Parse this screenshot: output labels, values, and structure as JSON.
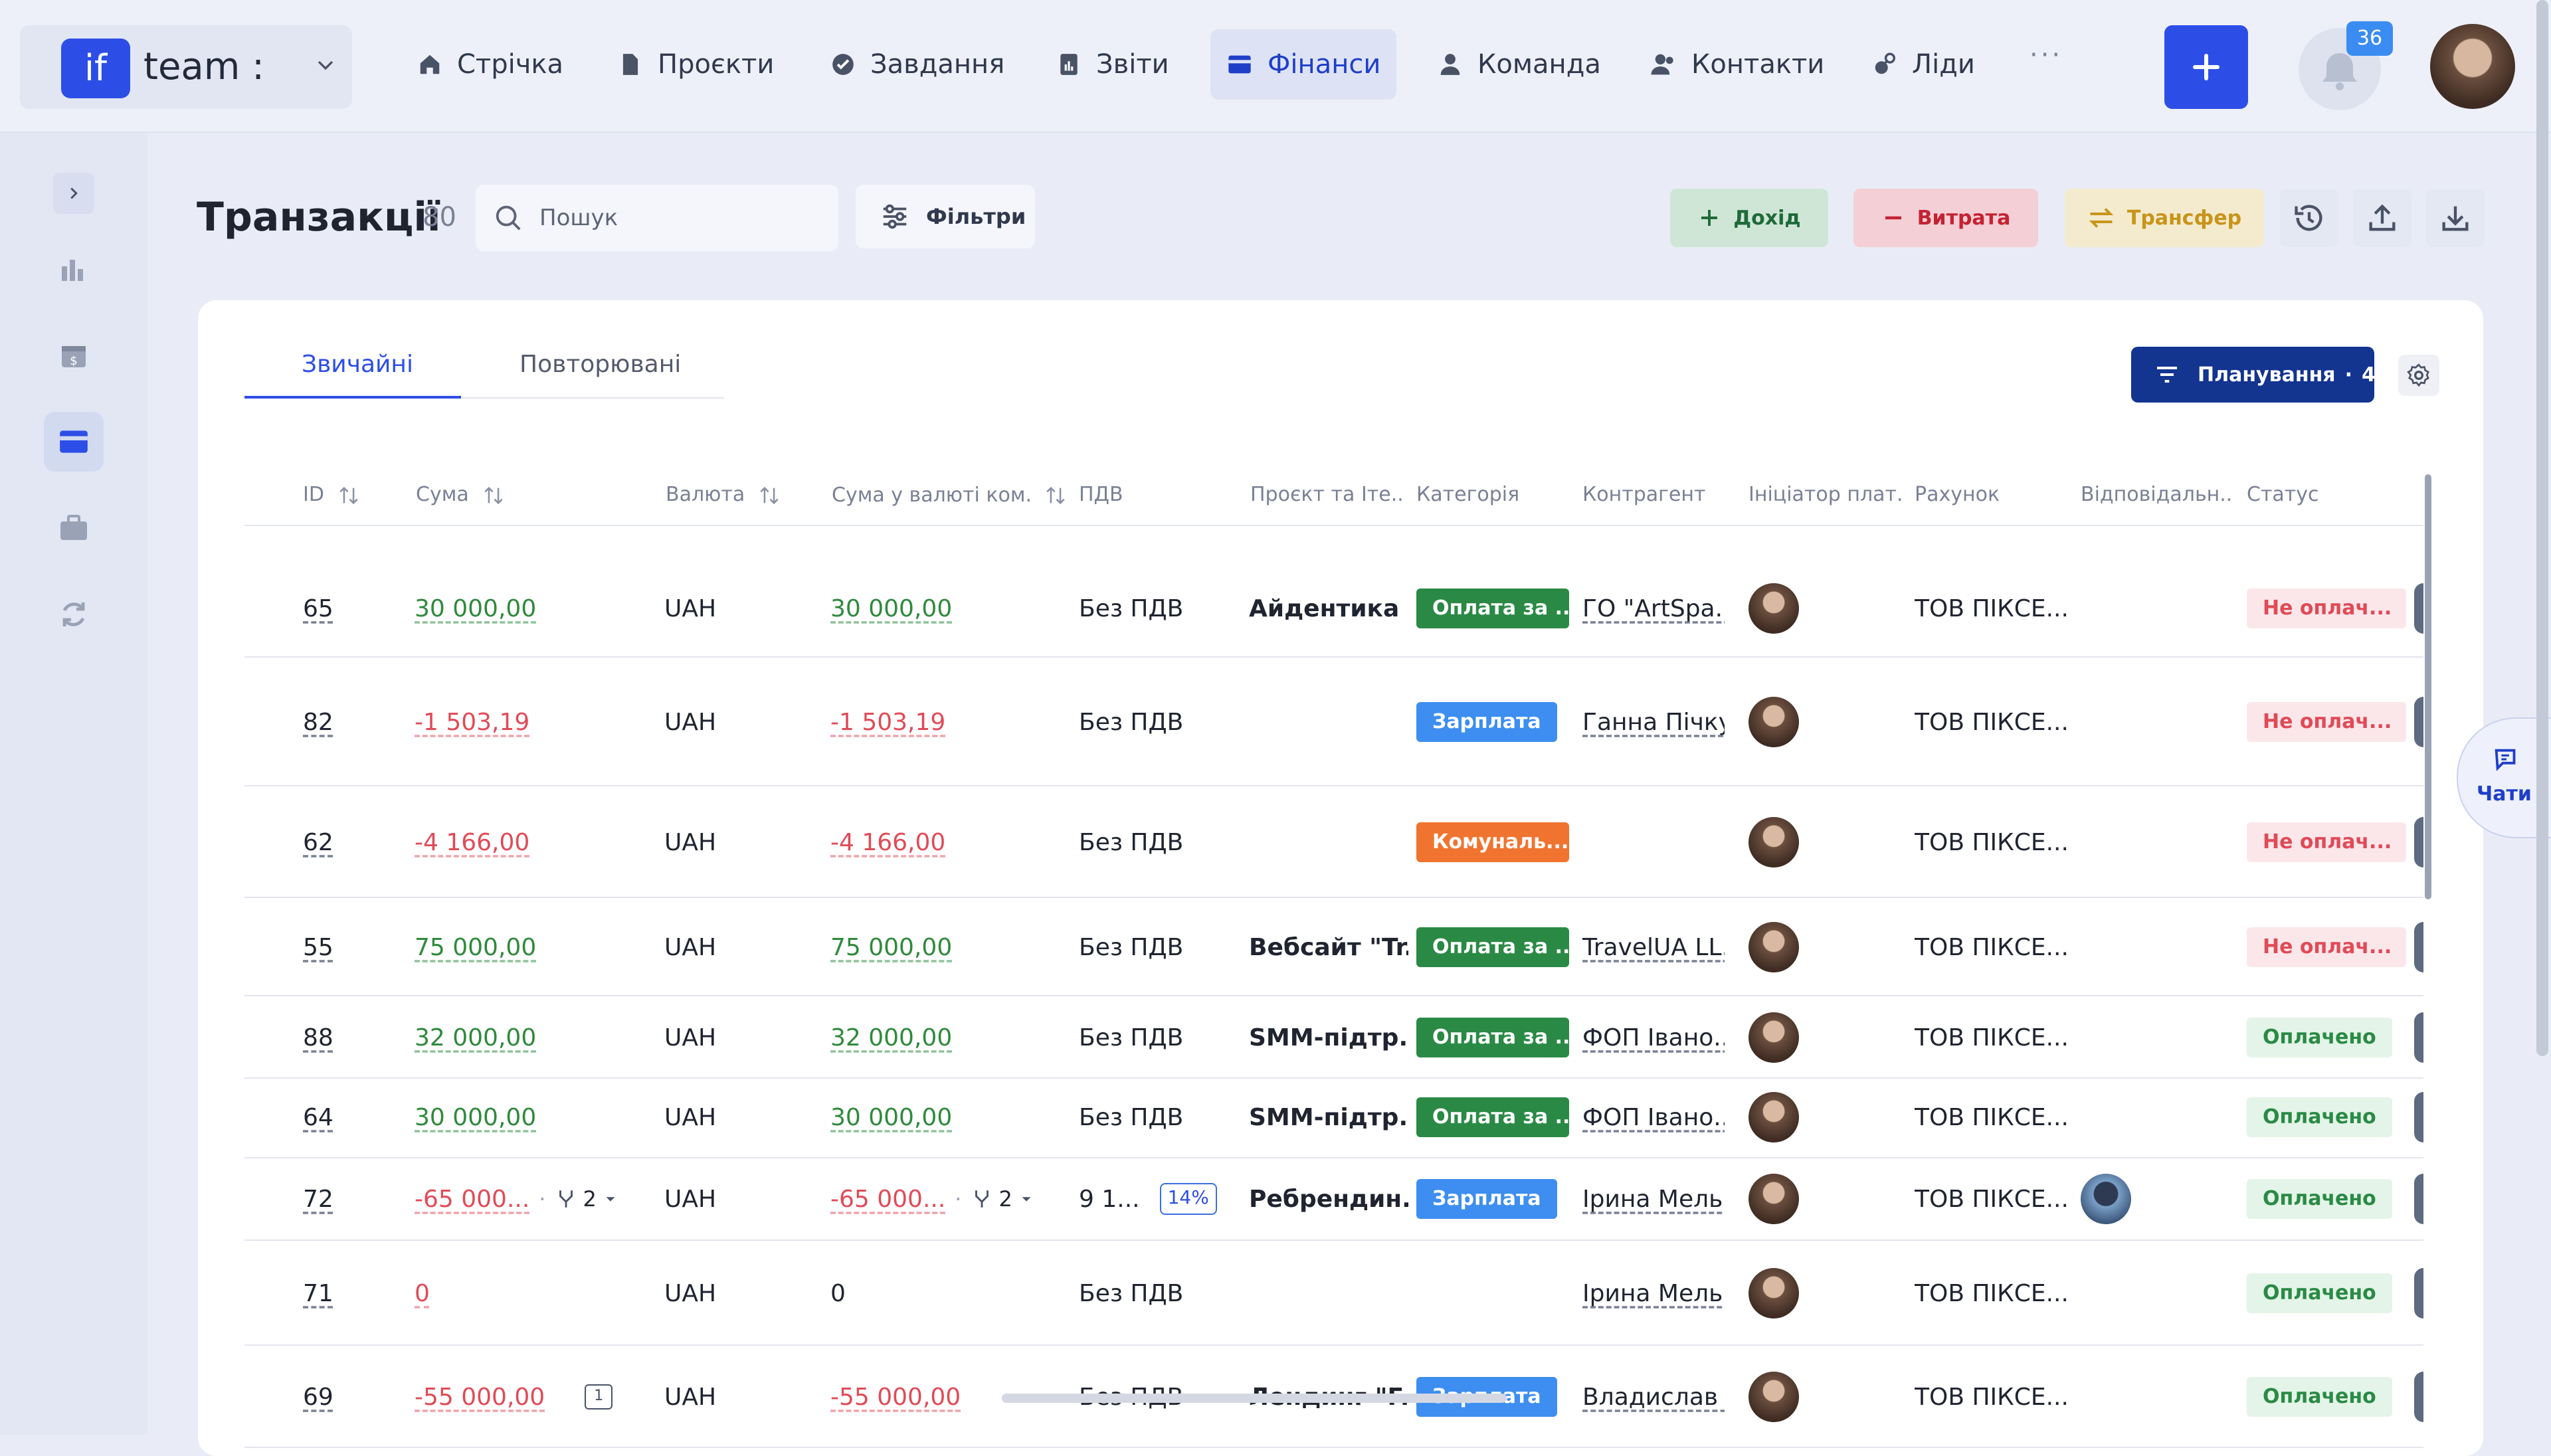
{
  "workspace": {
    "logo": "if",
    "name": "team :"
  },
  "nav": [
    {
      "label": "Стрічка",
      "icon": "home-icon"
    },
    {
      "label": "Проєкти",
      "icon": "file-icon"
    },
    {
      "label": "Завдання",
      "icon": "check-circle-icon"
    },
    {
      "label": "Звіти",
      "icon": "report-icon"
    },
    {
      "label": "Фінанси",
      "icon": "wallet-icon",
      "active": true
    },
    {
      "label": "Команда",
      "icon": "person-icon"
    },
    {
      "label": "Контакти",
      "icon": "contacts-icon"
    },
    {
      "label": "Ліди",
      "icon": "leads-icon"
    }
  ],
  "nav_more": "···",
  "notifications": {
    "count": "36"
  },
  "page": {
    "title": "Транзакції",
    "count": "80"
  },
  "search": {
    "placeholder": "Пошук"
  },
  "filters_label": "Фільтри",
  "actions": {
    "income": "Дохід",
    "expense": "Витрата",
    "transfer": "Трансфер"
  },
  "tabs": {
    "regular": "Звичайні",
    "recurring": "Повторювані"
  },
  "planning": {
    "label": "Планування",
    "count": "4"
  },
  "columns": {
    "id": "ID",
    "amount": "Сума",
    "currency": "Валюта",
    "company_amount": "Сума у валюті ком...",
    "vat": "ПДВ",
    "project": "Проєкт та Іте...",
    "category": "Категорія",
    "counterparty": "Контрагент",
    "initiator": "Ініціатор плат...",
    "account": "Рахунок",
    "responsible": "Відповідальн...",
    "status": "Статус"
  },
  "rows": [
    {
      "id": "65",
      "amount": "30 000,00",
      "sign": "pos",
      "currency": "UAH",
      "company_amount": "30 000,00",
      "vat": "Без ПДВ",
      "project": "Айдентика ...",
      "category": "Оплата за ...",
      "category_color": "green",
      "counterparty": "ГО \"ArtSpa...",
      "account": "ТОВ ПІКСЕ...",
      "status": "Не оплач...",
      "status_type": "unpaid"
    },
    {
      "id": "82",
      "amount": "-1 503,19",
      "sign": "neg",
      "currency": "UAH",
      "company_amount": "-1 503,19",
      "vat": "Без ПДВ",
      "project": "",
      "category": "Зарплата",
      "category_color": "blue",
      "counterparty": "Ганна Пічкур",
      "account": "ТОВ ПІКСЕ...",
      "status": "Не оплач...",
      "status_type": "unpaid"
    },
    {
      "id": "62",
      "amount": "-4 166,00",
      "sign": "neg",
      "currency": "UAH",
      "company_amount": "-4 166,00",
      "vat": "Без ПДВ",
      "project": "",
      "category": "Комуналь...",
      "category_color": "orange",
      "counterparty": "",
      "account": "ТОВ ПІКСЕ...",
      "status": "Не оплач...",
      "status_type": "unpaid"
    },
    {
      "id": "55",
      "amount": "75 000,00",
      "sign": "pos",
      "currency": "UAH",
      "company_amount": "75 000,00",
      "vat": "Без ПДВ",
      "project": "Вебсайт \"Tr...",
      "category": "Оплата за ...",
      "category_color": "green",
      "counterparty": "TravelUA LL...",
      "account": "ТОВ ПІКСЕ...",
      "status": "Не оплач...",
      "status_type": "unpaid"
    },
    {
      "id": "88",
      "amount": "32 000,00",
      "sign": "pos",
      "currency": "UAH",
      "company_amount": "32 000,00",
      "vat": "Без ПДВ",
      "project": "SMM-підтр...",
      "category": "Оплата за ...",
      "category_color": "green",
      "counterparty": "ФОП Івано...",
      "account": "ТОВ ПІКСЕ...",
      "status": "Оплачено",
      "status_type": "paid"
    },
    {
      "id": "64",
      "amount": "30 000,00",
      "sign": "pos",
      "currency": "UAH",
      "company_amount": "30 000,00",
      "vat": "Без ПДВ",
      "project": "SMM-підтр...",
      "category": "Оплата за ...",
      "category_color": "green",
      "counterparty": "ФОП Івано...",
      "account": "ТОВ ПІКСЕ...",
      "status": "Оплачено",
      "status_type": "paid"
    },
    {
      "id": "72",
      "amount": "-65 000...",
      "sign": "neg",
      "split": "2",
      "currency": "UAH",
      "company_amount": "-65 000...",
      "vat": "9 1...",
      "vat_pct": "14%",
      "project": "Ребрендин...",
      "category": "Зарплата",
      "category_color": "blue",
      "counterparty": "Ірина Мельн",
      "account": "ТОВ ПІКСЕ...",
      "status": "Оплачено",
      "status_type": "paid"
    },
    {
      "id": "71",
      "amount": "0",
      "sign": "neg",
      "currency": "UAH",
      "company_amount": "0",
      "vat": "Без ПДВ",
      "project": "",
      "category": "",
      "category_color": "",
      "counterparty": "Ірина Мельн",
      "account": "ТОВ ПІКСЕ...",
      "status": "Оплачено",
      "status_type": "paid"
    },
    {
      "id": "69",
      "amount": "-55 000,00",
      "sign": "neg",
      "comment_count": "1",
      "currency": "UAH",
      "company_amount": "-55 000,00",
      "vat": "Без ПДВ",
      "project": "Лендинг \"F...",
      "category": "Зарплата",
      "category_color": "blue",
      "counterparty": "Владислав Ч",
      "account": "ТОВ ПІКСЕ...",
      "status": "Оплачено",
      "status_type": "paid"
    }
  ],
  "chat_tab": "Чати"
}
